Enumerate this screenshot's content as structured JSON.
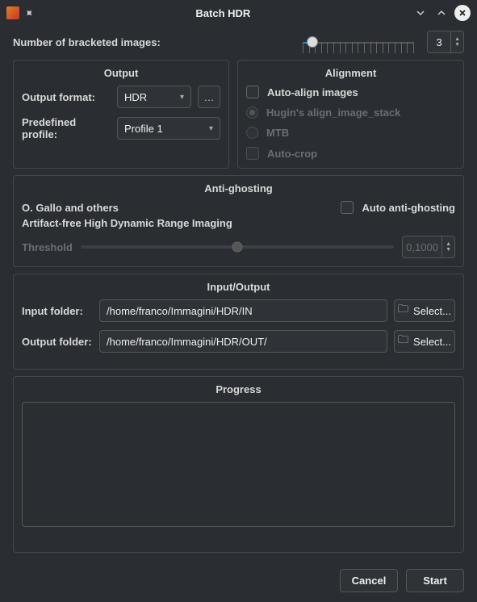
{
  "title": "Batch HDR",
  "bracketed": {
    "label": "Number of bracketed images:",
    "value": "3"
  },
  "output": {
    "legend": "Output",
    "format_label": "Output format:",
    "format_value": "HDR",
    "profile_label": "Predefined profile:",
    "profile_value": "Profile 1"
  },
  "alignment": {
    "legend": "Alignment",
    "auto_align": "Auto-align images",
    "hugin": "Hugin's align_image_stack",
    "mtb": "MTB",
    "auto_crop": "Auto-crop"
  },
  "antighost": {
    "legend": "Anti-ghosting",
    "line1": "O. Gallo and others",
    "line2": "Artifact-free High Dynamic Range Imaging",
    "auto_label": "Auto anti-ghosting",
    "threshold_label": "Threshold",
    "threshold_value": "0,1000"
  },
  "io": {
    "legend": "Input/Output",
    "input_label": "Input folder:",
    "input_value": "/home/franco/Immagini/HDR/IN",
    "output_label": "Output folder:",
    "output_value": "/home/franco/Immagini/HDR/OUT/",
    "select_label": "Select..."
  },
  "progress": {
    "legend": "Progress"
  },
  "buttons": {
    "cancel": "Cancel",
    "start": "Start"
  }
}
